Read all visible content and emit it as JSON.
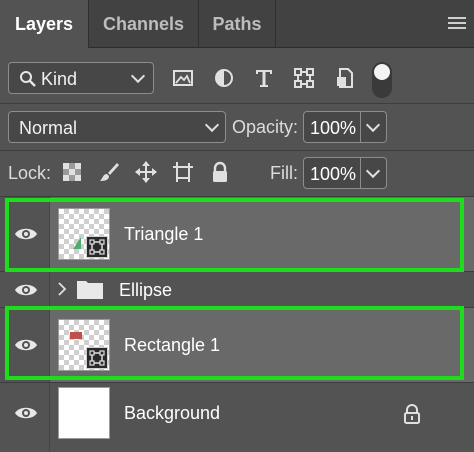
{
  "tabs": [
    {
      "label": "Layers",
      "active": true
    },
    {
      "label": "Channels",
      "active": false
    },
    {
      "label": "Paths",
      "active": false
    }
  ],
  "filter": {
    "kind_label": "Kind",
    "icons": [
      "image-filter-icon",
      "adjustment-filter-icon",
      "type-filter-icon",
      "shape-filter-icon",
      "smart-object-filter-icon"
    ]
  },
  "blend": {
    "mode": "Normal"
  },
  "opacity": {
    "label": "Opacity:",
    "value": "100%"
  },
  "lock": {
    "label": "Lock:",
    "icons": [
      "lock-transparent-pixels-icon",
      "lock-image-pixels-icon",
      "lock-position-icon",
      "lock-artboard-icon",
      "lock-all-icon"
    ]
  },
  "fill": {
    "label": "Fill:",
    "value": "100%"
  },
  "layers": [
    {
      "name": "Triangle 1",
      "type": "shape",
      "selected": true,
      "visible": true
    },
    {
      "name": "Ellipse",
      "type": "group",
      "selected": false,
      "visible": true
    },
    {
      "name": "Rectangle 1",
      "type": "shape",
      "selected": true,
      "visible": true
    },
    {
      "name": "Background",
      "type": "background",
      "selected": false,
      "visible": true,
      "locked": true
    }
  ],
  "colors": {
    "highlight": "#1fdc1f",
    "panel": "#535353",
    "selected_row": "#696969",
    "triangle_fill": "#4caf6e",
    "rectangle_fill": "#c0504d"
  }
}
